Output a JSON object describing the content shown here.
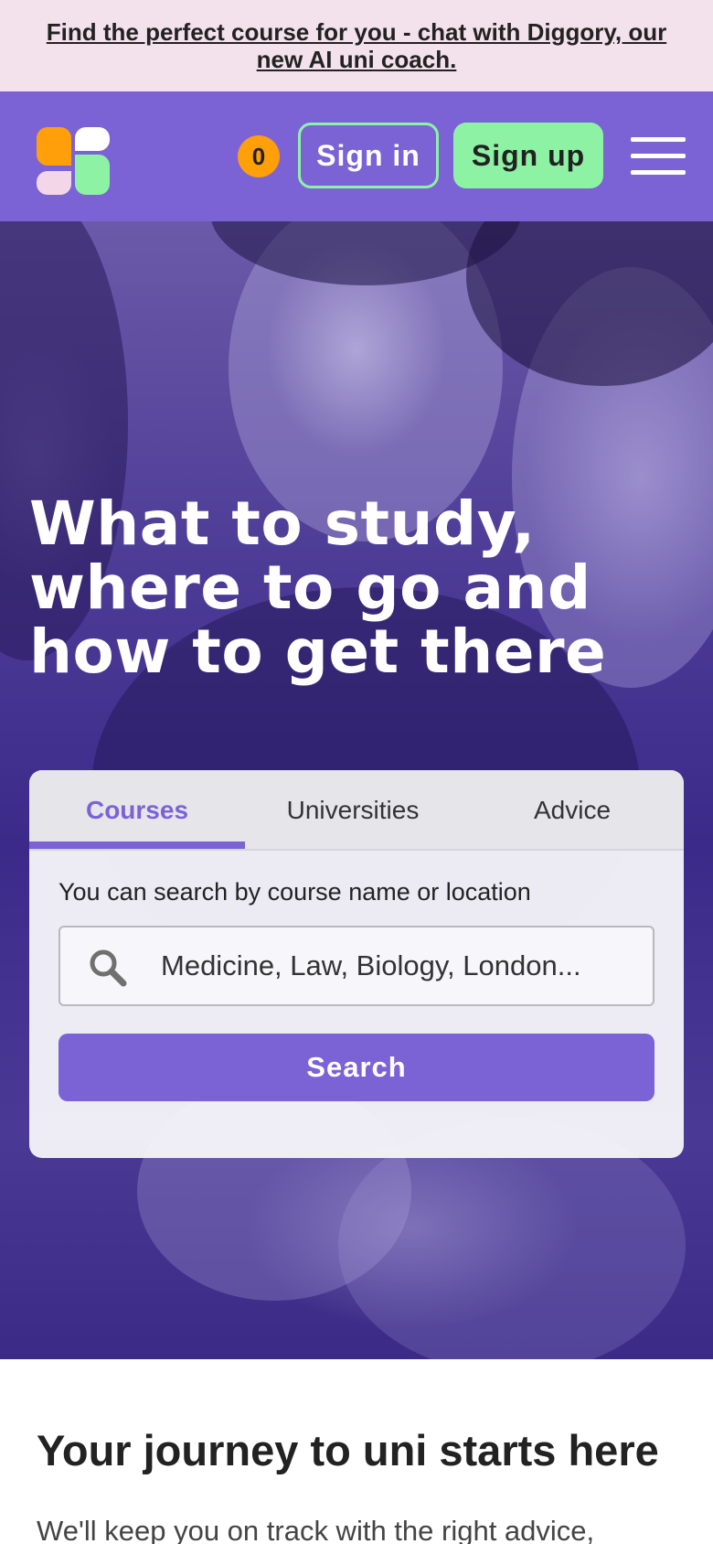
{
  "promo": {
    "text": "Find the perfect course for you - chat with Diggory, our new AI uni coach."
  },
  "header": {
    "logo_icon": "brand-logo-blocks",
    "saved_count": "0",
    "sign_in_label": "Sign in",
    "sign_up_label": "Sign up",
    "menu_icon": "hamburger-menu-icon"
  },
  "hero": {
    "title": "What to study, where to go and how to get there",
    "search": {
      "tabs": [
        {
          "label": "Courses",
          "active": true
        },
        {
          "label": "Universities",
          "active": false
        },
        {
          "label": "Advice",
          "active": false
        }
      ],
      "hint": "You can search by course name or location",
      "placeholder": "Medicine, Law, Biology, London...",
      "button_label": "Search"
    }
  },
  "journey": {
    "heading": "Your journey to uni starts here",
    "subtext": "We'll keep you on track with the right advice,"
  },
  "colors": {
    "brand_purple": "#7b63d6",
    "accent_green": "#8ef2a4",
    "accent_orange": "#ff9f0a",
    "promo_pink": "#f3e1ec"
  }
}
